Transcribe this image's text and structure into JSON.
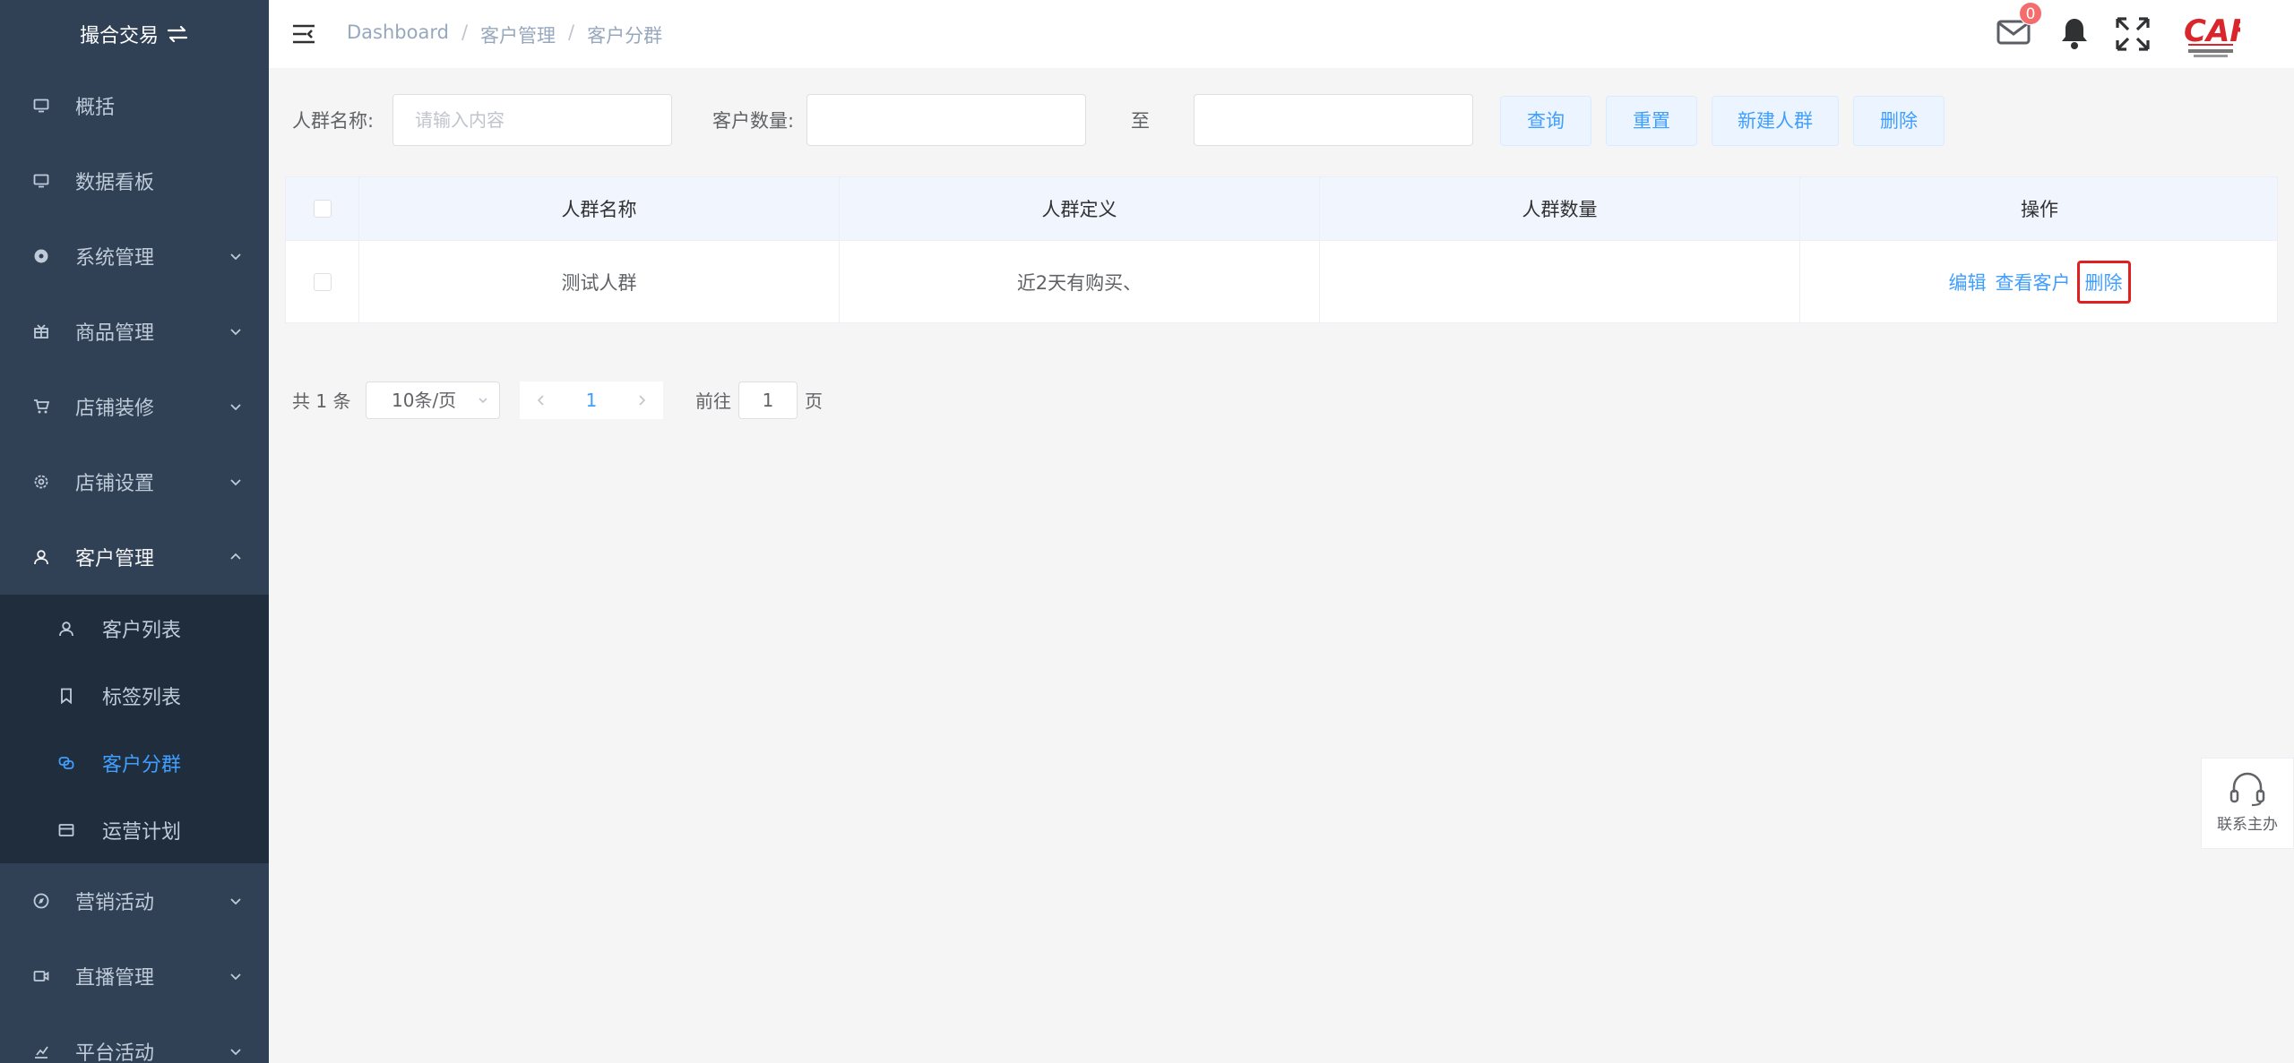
{
  "sidebar": {
    "title": "撮合交易",
    "items": [
      {
        "label": "概括"
      },
      {
        "label": "数据看板"
      },
      {
        "label": "系统管理"
      },
      {
        "label": "商品管理"
      },
      {
        "label": "店铺装修"
      },
      {
        "label": "店铺设置"
      },
      {
        "label": "客户管理"
      },
      {
        "label": "营销活动"
      },
      {
        "label": "直播管理"
      },
      {
        "label": "平台活动"
      }
    ],
    "sub_items": [
      {
        "label": "客户列表"
      },
      {
        "label": "标签列表"
      },
      {
        "label": "客户分群"
      },
      {
        "label": "运营计划"
      }
    ]
  },
  "header": {
    "breadcrumb": [
      "Dashboard",
      "客户管理",
      "客户分群"
    ],
    "breadcrumb_sep": "/",
    "mail_badge": "0"
  },
  "filter": {
    "name_label": "人群名称:",
    "name_placeholder": "请输入内容",
    "count_label": "客户数量:",
    "to_label": "至",
    "buttons": {
      "query": "查询",
      "reset": "重置",
      "create": "新建人群",
      "delete": "删除"
    }
  },
  "table": {
    "columns": [
      "人群名称",
      "人群定义",
      "人群数量",
      "操作"
    ],
    "rows": [
      {
        "name": "测试人群",
        "definition": "近2天有购买、",
        "count": "",
        "actions": {
          "edit": "编辑",
          "view": "查看客户",
          "delete": "删除"
        }
      }
    ]
  },
  "pagination": {
    "total": "共 1 条",
    "page_size": "10条/页",
    "current_page": "1",
    "goto_label": "前往",
    "goto_value": "1",
    "page_suffix": "页"
  },
  "contact": {
    "label": "联系主办"
  },
  "colors": {
    "sidebar_bg": "#304156",
    "submenu_bg": "#1f2d3d",
    "primary": "#409eff",
    "highlight_box": "#e02020",
    "badge": "#f56c6c"
  }
}
